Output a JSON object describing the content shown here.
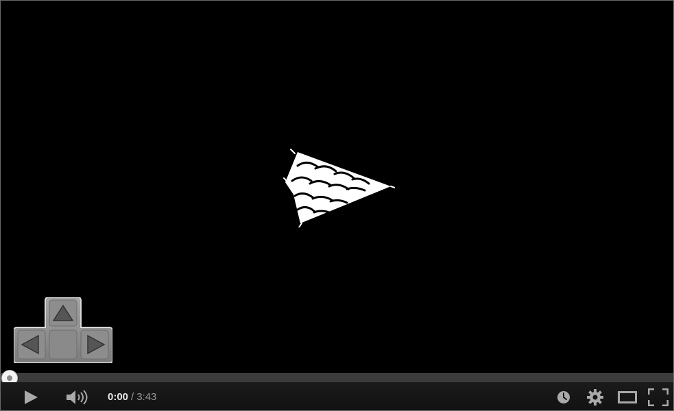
{
  "player": {
    "time": {
      "current": "0:00",
      "separator": "/",
      "duration": "3:43"
    },
    "progress_fraction": 0,
    "icons": {
      "big_play": "sketch-play-arrow-icon",
      "dpad": "arrow-keys-dpad-icon",
      "play": "play-icon",
      "volume": "volume-icon",
      "watch_later": "clock-icon",
      "settings": "gear-icon",
      "theater": "theater-mode-icon",
      "fullscreen": "fullscreen-icon"
    },
    "colors": {
      "background": "#000000",
      "control_bar": "#1b1b1b",
      "icon": "#a9a9a9",
      "progress_track": "#3c3c3c",
      "progress_played": "#cc181e"
    }
  }
}
